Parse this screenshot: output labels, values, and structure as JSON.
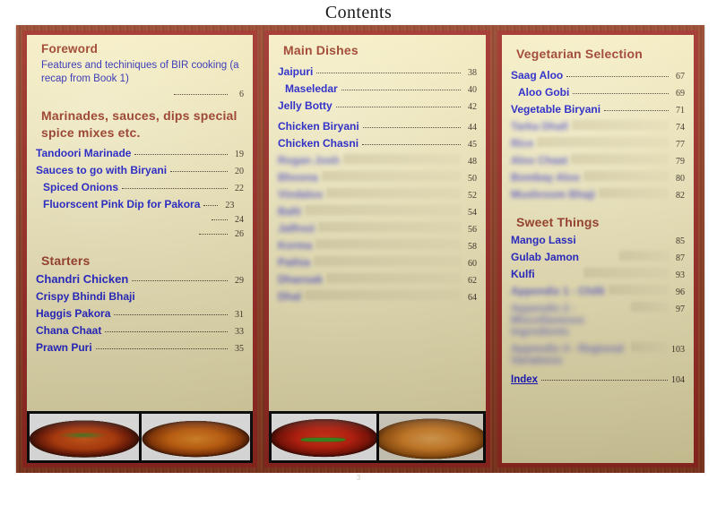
{
  "header": {
    "title": "Contents"
  },
  "folio": "3",
  "colors": {
    "panel_bg": "#f4edc2",
    "panel_border": "#9d2b23",
    "heading": "#9c3b26",
    "entry": "#2222cc",
    "page_number": "#3a3226",
    "frame_wood": "#8e3b22"
  },
  "panels": {
    "left": {
      "sections": [
        {
          "heading": "Foreword",
          "note": "Features and techiniques of BIR cooking (a recap from Book 1)",
          "entries": [
            {
              "label": "",
              "page": "6"
            }
          ]
        },
        {
          "heading": "Marinades, sauces, dips special spice mixes etc.",
          "entries": [
            {
              "label": "Tandoori Marinade",
              "page": "19"
            },
            {
              "label": "Sauces to go with Biryani",
              "page": "20"
            },
            {
              "label": "Spiced Onions",
              "page": "22"
            },
            {
              "label": "Fluorscent Pink Dip for Pakora",
              "page": "23"
            },
            {
              "label": "",
              "page": "24"
            },
            {
              "label": "",
              "page": "26"
            }
          ]
        },
        {
          "heading": "Starters",
          "entries": [
            {
              "label": "Chandri Chicken",
              "page": "29"
            },
            {
              "label": "Crispy Bhindi Bhaji",
              "page": ""
            },
            {
              "label": "Haggis Pakora",
              "page": "31"
            },
            {
              "label": "Chana Chaat",
              "page": "33"
            },
            {
              "label": "Prawn Puri",
              "page": "35"
            }
          ]
        }
      ]
    },
    "middle": {
      "sections": [
        {
          "heading": "Main Dishes",
          "entries": [
            {
              "label": "Jaipuri",
              "page": "38"
            },
            {
              "label": "Maseledar",
              "page": "40"
            },
            {
              "label": "Jelly Botty",
              "page": "42"
            },
            {
              "label": "Chicken Biryani",
              "page": "44"
            },
            {
              "label": "Chicken Chasni",
              "page": "45"
            },
            {
              "label": "Rogan Josh",
              "page": "48",
              "blurred": true
            },
            {
              "label": "Bhoona",
              "page": "50",
              "blurred": true
            },
            {
              "label": "Vindaloo",
              "page": "52",
              "blurred": true
            },
            {
              "label": "Balti",
              "page": "54",
              "blurred": true
            },
            {
              "label": "Jalfrezi",
              "page": "56",
              "blurred": true
            },
            {
              "label": "Korma",
              "page": "58",
              "blurred": true
            },
            {
              "label": "Pathia",
              "page": "60",
              "blurred": true
            },
            {
              "label": "Dhansak",
              "page": "62",
              "blurred": true
            },
            {
              "label": "Dhal",
              "page": "64",
              "blurred": true
            }
          ]
        }
      ]
    },
    "right": {
      "sections": [
        {
          "heading": "Vegetarian Selection",
          "entries": [
            {
              "label": "Saag Aloo",
              "page": "67"
            },
            {
              "label": "Aloo Gobi",
              "page": "69"
            },
            {
              "label": "Vegetable Biryani",
              "page": "71"
            },
            {
              "label": "Tarka Dhall",
              "page": "74",
              "blurred": true
            },
            {
              "label": "Rice",
              "page": "77",
              "blurred": true
            },
            {
              "label": "Aloo Chaat",
              "page": "79",
              "blurred": true
            },
            {
              "label": "Bombay Aloo",
              "page": "80",
              "blurred": true
            },
            {
              "label": "Mushroom Bhaji",
              "page": "82",
              "blurred": true
            }
          ]
        },
        {
          "heading": "Sweet Things",
          "entries": [
            {
              "label": "Mango Lassi",
              "page": "85"
            },
            {
              "label": "Gulab Jamon",
              "page": "87"
            },
            {
              "label": "Kulfi",
              "page": "93"
            },
            {
              "label": "Appendix 1 - Chilli",
              "page": "96",
              "blurred": true
            },
            {
              "label": "Appendix 2 - Miscellaneous Ingredients",
              "page": "97",
              "blurred": true
            },
            {
              "label": "Appendix 3 - Regional Variations",
              "page": "103",
              "blurred": true
            }
          ]
        },
        {
          "heading": "",
          "entries": [
            {
              "label": "Index",
              "page": "104",
              "index": true
            }
          ]
        }
      ]
    }
  },
  "photos": [
    {
      "name": "photo-chicken-curry-garnished",
      "style": "curry-a"
    },
    {
      "name": "photo-orange-curry-bowl",
      "style": "curry-b"
    },
    {
      "name": "photo-red-curry-green-chilli",
      "style": "curry-c"
    },
    {
      "name": "photo-tan-curry-dish",
      "style": "curry-d"
    }
  ]
}
